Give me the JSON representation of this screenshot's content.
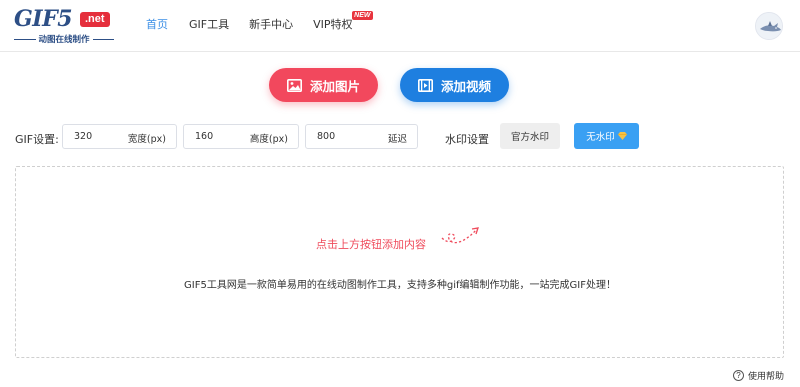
{
  "logo": {
    "main": "GIF5",
    "badge": ".net",
    "tagline": "动图在线制作"
  },
  "nav": [
    {
      "label": "首页",
      "active": true
    },
    {
      "label": "GIF工具",
      "active": false
    },
    {
      "label": "新手中心",
      "active": false
    },
    {
      "label": "VIP特权",
      "active": false,
      "badge": "NEW"
    }
  ],
  "upload": {
    "image_label": "添加图片",
    "video_label": "添加视频"
  },
  "gif_settings": {
    "label": "GIF设置:",
    "width": {
      "value": "320",
      "unit": "宽度(px)"
    },
    "height": {
      "value": "160",
      "unit": "高度(px)"
    },
    "delay": {
      "value": "800",
      "unit": "延迟"
    }
  },
  "watermark": {
    "label": "水印设置",
    "official": "官方水印",
    "none": "无水印"
  },
  "dropzone": {
    "hint": "点击上方按钮添加内容",
    "description": "GIF5工具网是一款简单易用的在线动图制作工具，支持多种gif编辑制作功能，一站完成GIF处理！"
  },
  "help": {
    "label": "使用帮助"
  },
  "colors": {
    "accent_blue": "#1e7fe0",
    "accent_red": "#f2485d",
    "nav_active": "#3c8fe6"
  }
}
